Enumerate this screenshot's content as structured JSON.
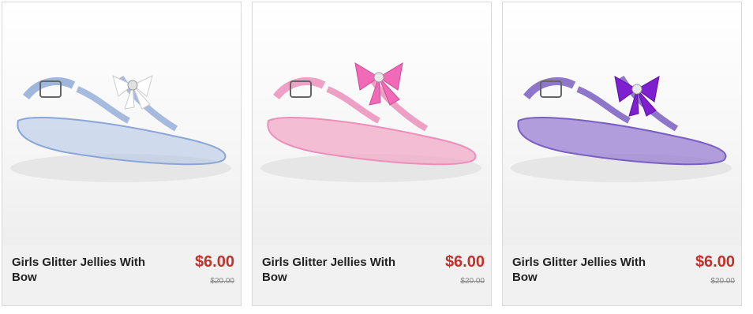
{
  "products": [
    {
      "title": "Girls Glitter Jellies With Bow",
      "price": "$6.00",
      "original_price": "$20.00",
      "color": "#aec4e6",
      "bow_color": "#ffffff"
    },
    {
      "title": "Girls Glitter Jellies With Bow",
      "price": "$6.00",
      "original_price": "$20.00",
      "color": "#f2a9c8",
      "bow_color": "#f06ab8"
    },
    {
      "title": "Girls Glitter Jellies With Bow",
      "price": "$6.00",
      "original_price": "$20.00",
      "color": "#9a7fd2",
      "bow_color": "#7e1fd0"
    }
  ]
}
